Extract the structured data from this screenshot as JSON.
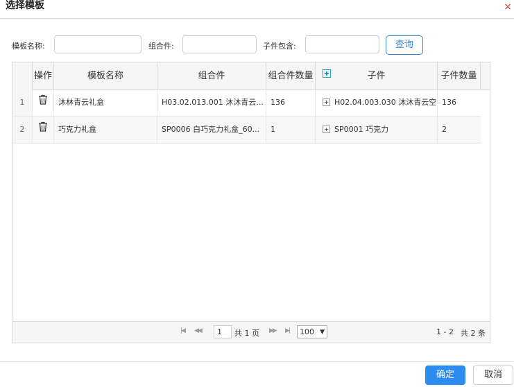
{
  "dialog": {
    "title": "选择模板",
    "close_glyph": "×"
  },
  "filters": {
    "template_name_label": "模板名称:",
    "template_name_value": "",
    "assembly_label": "组合件:",
    "assembly_value": "",
    "child_contains_label": "子件包含:",
    "child_contains_value": "",
    "query_button": "查询"
  },
  "grid": {
    "columns": [
      "操作",
      "模板名称",
      "组合件",
      "组合件数量",
      "子件",
      "子件数量"
    ],
    "rows": [
      {
        "index": "1",
        "template_name": "沐林青云礼盒",
        "assembly": "H03.02.013.001 沐沐青云...",
        "assembly_qty": "136",
        "child": "H02.04.003.030 沐沐青云空:",
        "child_qty": "136"
      },
      {
        "index": "2",
        "template_name": "巧克力礼盒",
        "assembly": "SP0006 白巧克力礼盒_60...",
        "assembly_qty": "1",
        "child": "SP0001 巧克力",
        "child_qty": "2"
      }
    ]
  },
  "pager": {
    "first_icon": "first-page-icon",
    "prev_icon": "prev-page-icon",
    "next_icon": "next-page-icon",
    "last_icon": "last-page-icon",
    "current_page": "1",
    "total_pages_text": "共 1 页",
    "page_size": "100",
    "range_text": "1 - 2",
    "total_text": "共 2 条"
  },
  "footer": {
    "ok_button": "确定",
    "cancel_button": "取消"
  },
  "colors": {
    "primary": "#2d8cf0",
    "query_border": "#3a8ad6",
    "close": "#d9342b",
    "expander": "#1ca0c8"
  }
}
